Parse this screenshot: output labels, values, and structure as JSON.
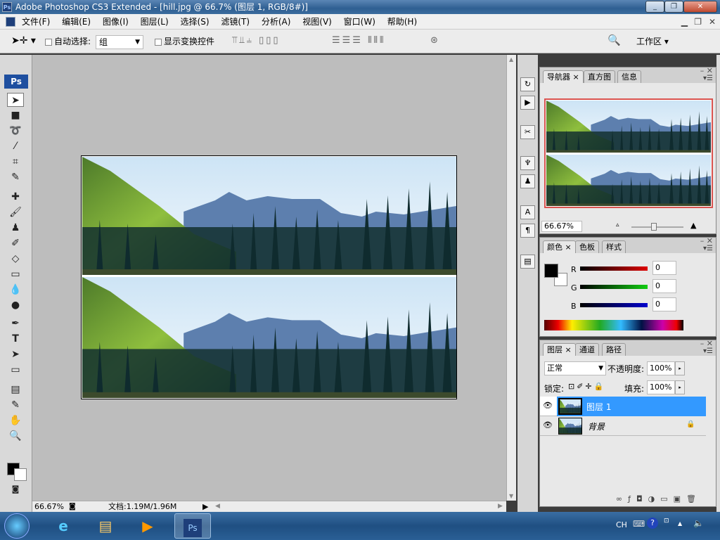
{
  "window": {
    "title": "Adobe Photoshop CS3 Extended - [hill.jpg @ 66.7% (图层 1, RGB/8#)]",
    "app_icon": "Ps"
  },
  "menu": [
    "文件(F)",
    "编辑(E)",
    "图像(I)",
    "图层(L)",
    "选择(S)",
    "滤镜(T)",
    "分析(A)",
    "视图(V)",
    "窗口(W)",
    "帮助(H)"
  ],
  "options": {
    "auto_select_label": "自动选择:",
    "auto_select_value": "组",
    "show_transform_label": "显示变换控件",
    "workspace_label": "工作区 ▾"
  },
  "status": {
    "zoom": "66.67%",
    "doc": "文档:1.19M/1.96M"
  },
  "navigator": {
    "tabs": [
      "导航器",
      "直方图",
      "信息"
    ],
    "zoom": "66.67%"
  },
  "color": {
    "tabs": [
      "颜色",
      "色板",
      "样式"
    ],
    "r_label": "R",
    "g_label": "G",
    "b_label": "B",
    "r": "0",
    "g": "0",
    "b": "0",
    "foreground": "#000000",
    "background": "#ffffff"
  },
  "layers": {
    "tabs": [
      "图层",
      "通道",
      "路径"
    ],
    "blend_mode": "正常",
    "opacity_label": "不透明度:",
    "opacity": "100%",
    "lock_label": "锁定:",
    "fill_label": "填充:",
    "fill": "100%",
    "items": [
      {
        "name": "图层 1",
        "selected": true
      },
      {
        "name": "背景",
        "locked": true
      }
    ]
  },
  "taskbar": {
    "lang": "CH",
    "ps_label": "Ps"
  },
  "colors": {
    "selection": "#3399ff",
    "navigator_frame": "#d9534f"
  }
}
